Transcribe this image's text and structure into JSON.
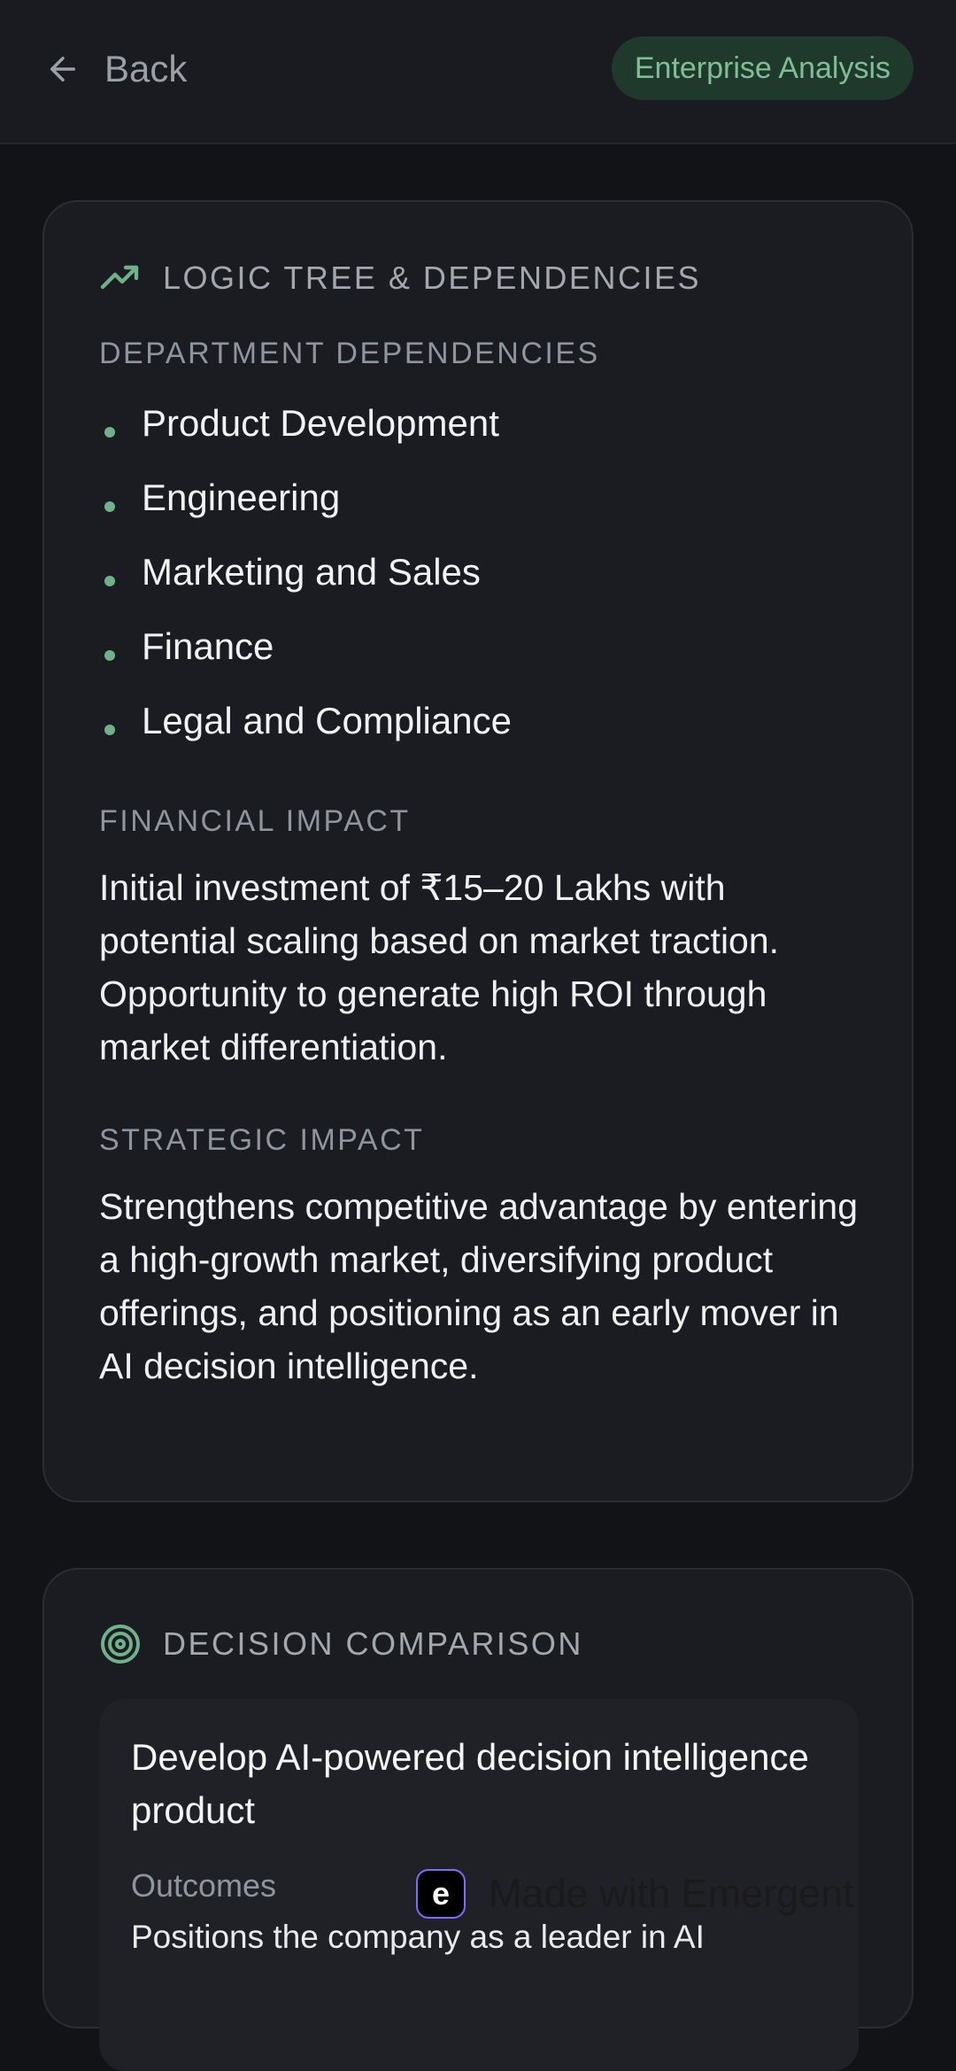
{
  "header": {
    "back_label": "Back",
    "badge_label": "Enterprise Analysis"
  },
  "logic_tree": {
    "title": "LOGIC TREE & DEPENDENCIES",
    "icon": "trending-up-icon",
    "department_label": "DEPARTMENT DEPENDENCIES",
    "departments": [
      "Product Development",
      "Engineering",
      "Marketing and Sales",
      "Finance",
      "Legal and Compliance"
    ],
    "financial_label": "FINANCIAL IMPACT",
    "financial_text": "Initial investment of ₹15–20 Lakhs with potential scaling based on market traction. Opportunity to generate high ROI through market differentiation.",
    "strategic_label": "STRATEGIC IMPACT",
    "strategic_text": "Strengthens competitive advantage by entering a high-growth market, diversifying product offerings, and positioning as an early mover in AI decision intelligence."
  },
  "decision_comparison": {
    "title": "DECISION COMPARISON",
    "icon": "target-icon",
    "option": {
      "title": "Develop AI-powered decision intelligence product",
      "outcomes_label": "Outcomes",
      "outcomes_text": "Positions the company as a leader in AI"
    }
  },
  "watermark": {
    "label": "Made with Emergent",
    "icon": "emergent-logo-icon"
  },
  "colors": {
    "accent_green": "#6fb28a",
    "badge_bg": "#1f3a2c",
    "card_bg": "#1b1c21",
    "page_bg": "#121317"
  }
}
